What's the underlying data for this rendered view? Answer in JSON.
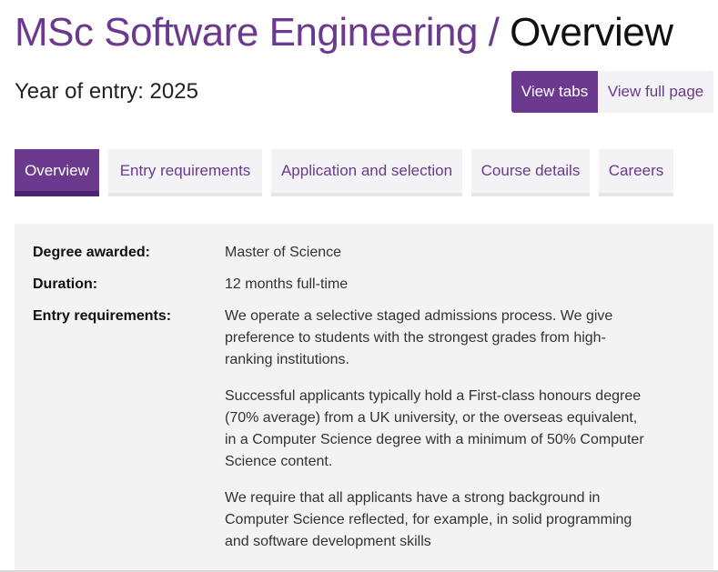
{
  "header": {
    "course_title": "MSc Software Engineering",
    "separator": "/",
    "page_title": "Overview",
    "year_of_entry": "Year of entry: 2025"
  },
  "view_toggle": {
    "tabs_label": "View tabs",
    "full_page_label": "View full page"
  },
  "tabs": [
    {
      "label": "Overview",
      "active": true
    },
    {
      "label": "Entry requirements",
      "active": false
    },
    {
      "label": "Application and selection",
      "active": false
    },
    {
      "label": "Course details",
      "active": false
    },
    {
      "label": "Careers",
      "active": false
    }
  ],
  "overview": {
    "degree_label": "Degree awarded:",
    "degree_value": "Master of Science",
    "duration_label": "Duration:",
    "duration_value": "12 months full-time",
    "entry_label": "Entry requirements:",
    "entry_paragraphs": [
      "We operate a selective staged admissions process. We give preference to students with the strongest grades from high-ranking institutions.",
      "Successful applicants typically hold a First-class honours degree (70% average) from a UK university, or the overseas equivalent, in a Computer Science degree with a minimum of 50% Computer Science content.",
      "We require that all applicants have a strong background in Computer Science reflected, for example, in solid programming and software development skills"
    ]
  },
  "colors": {
    "brand_purple": "#6b3a8e",
    "tab_background": "#f3f2f4",
    "panel_background": "#f3f3f4"
  }
}
